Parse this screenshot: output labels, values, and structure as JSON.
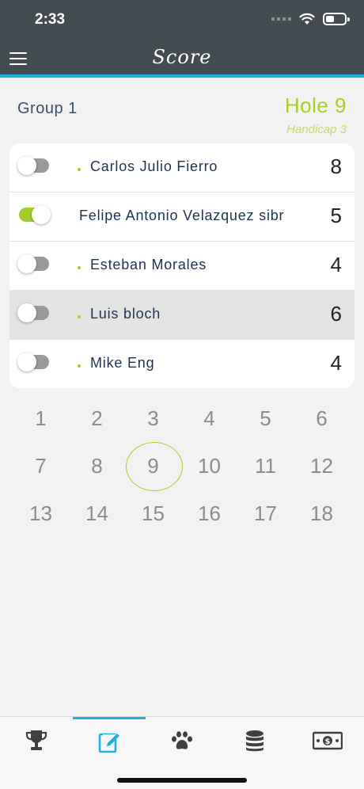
{
  "status_bar": {
    "time": "2:33"
  },
  "header": {
    "title": "Score"
  },
  "group": {
    "label": "Group 1",
    "hole": "Hole 9",
    "handicap": "Handicap 3"
  },
  "players": [
    {
      "name": "Carlos Julio Fierro",
      "score": "8",
      "toggle_on": false,
      "highlight": false,
      "dot": true
    },
    {
      "name": "Felipe Antonio Velazquez sibr",
      "score": "5",
      "toggle_on": true,
      "highlight": false,
      "dot": false
    },
    {
      "name": "Esteban Morales",
      "score": "4",
      "toggle_on": false,
      "highlight": false,
      "dot": true
    },
    {
      "name": "Luis bloch",
      "score": "6",
      "toggle_on": false,
      "highlight": true,
      "dot": true
    },
    {
      "name": "Mike Eng",
      "score": "4",
      "toggle_on": false,
      "highlight": false,
      "dot": true
    }
  ],
  "holes": [
    "1",
    "2",
    "3",
    "4",
    "5",
    "6",
    "7",
    "8",
    "9",
    "10",
    "11",
    "12",
    "13",
    "14",
    "15",
    "16",
    "17",
    "18"
  ],
  "selected_hole": "9",
  "tabs": [
    {
      "icon": "trophy-icon",
      "active": false
    },
    {
      "icon": "edit-icon",
      "active": true
    },
    {
      "icon": "paw-icon",
      "active": false
    },
    {
      "icon": "coins-icon",
      "active": false
    },
    {
      "icon": "money-icon",
      "active": false
    }
  ],
  "colors": {
    "header": "#434d51",
    "accent": "#1fb0e0",
    "green": "#a8cf25",
    "tab_icon": "#404040"
  }
}
